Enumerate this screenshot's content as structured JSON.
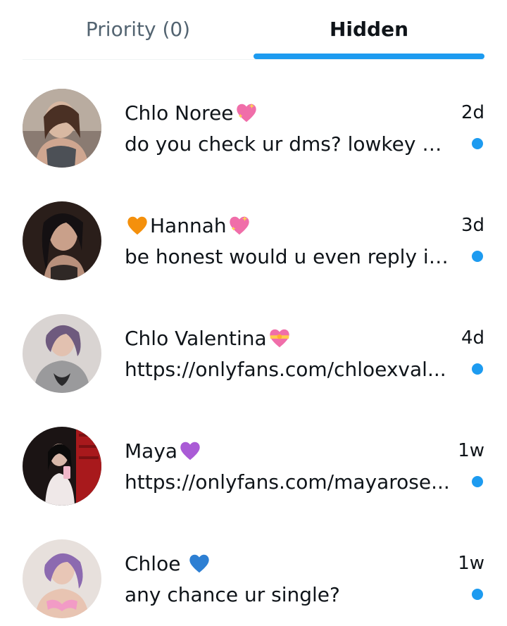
{
  "tabs": {
    "priority_label": "Priority (0)",
    "hidden_label": "Hidden",
    "active": "Hidden",
    "accent_color": "#1d9bf0"
  },
  "conversations": [
    {
      "name": "Chlo Noree",
      "name_suffix_icon": "sparkling-heart-icon",
      "time": "2d",
      "preview": "do you check ur dms? lowkey w...",
      "unread": true
    },
    {
      "name": "Hannah",
      "name_prefix_icon": "orange-heart-icon",
      "name_suffix_icon": "sparkling-heart-icon",
      "time": "3d",
      "preview": "be honest would u even reply if ...",
      "unread": true
    },
    {
      "name": "Chlo Valentina",
      "name_suffix_icon": "heart-with-ribbon-icon",
      "time": "4d",
      "preview": "https://onlyfans.com/chloexval...",
      "unread": true
    },
    {
      "name": "Maya",
      "name_suffix_icon": "purple-heart-icon",
      "time": "1w",
      "preview": "https://onlyfans.com/mayarose...",
      "unread": true
    },
    {
      "name": "Chloe ",
      "name_suffix_icon": "blue-heart-icon",
      "time": "1w",
      "preview": "any chance ur single?",
      "unread": true
    }
  ]
}
